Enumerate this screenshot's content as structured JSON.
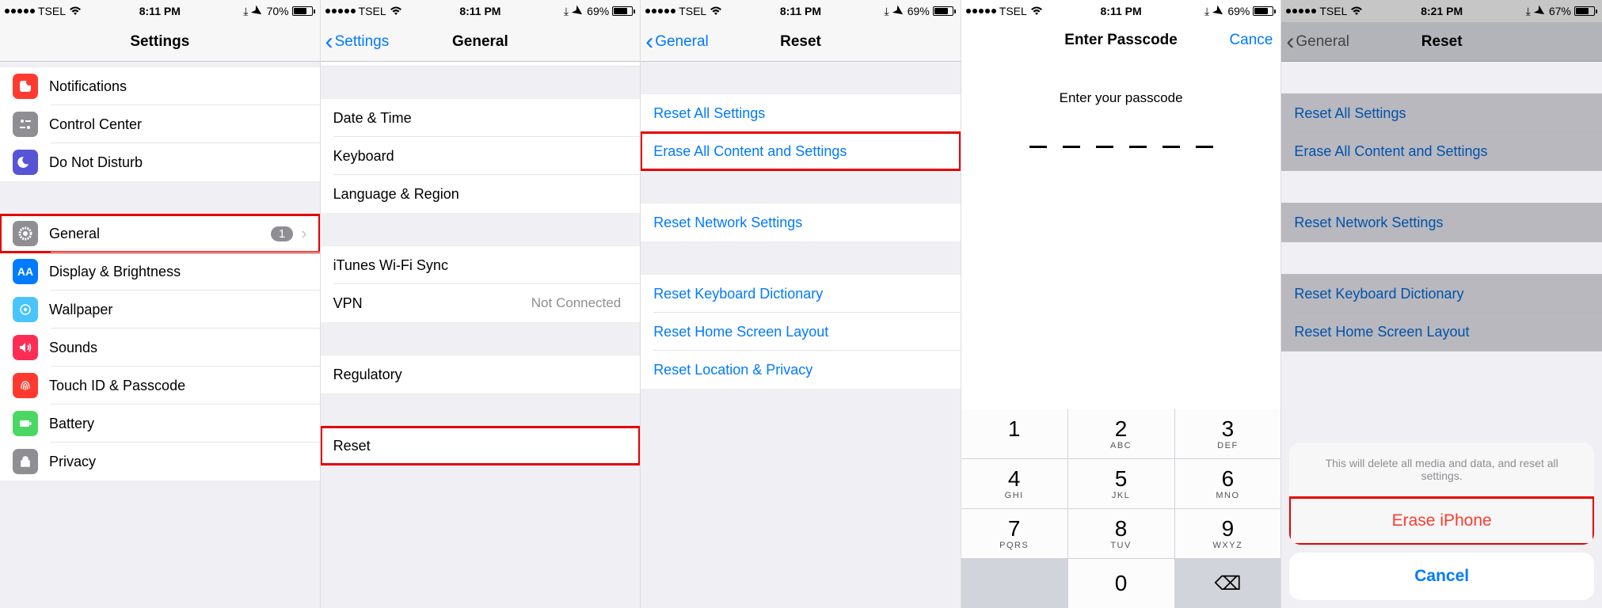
{
  "status": {
    "carrier": "TSEL",
    "time1": "8:11 PM",
    "time2": "8:11 PM",
    "time3": "8:11 PM",
    "time4": "8:11 PM",
    "time5": "8:21 PM",
    "bat1": "70%",
    "bat2": "69%",
    "bat3": "69%",
    "bat4": "69%",
    "bat5": "67%"
  },
  "s1": {
    "title": "Settings",
    "rows": {
      "notifications": "Notifications",
      "control_center": "Control Center",
      "dnd": "Do Not Disturb",
      "general": "General",
      "general_badge": "1",
      "display": "Display & Brightness",
      "wallpaper": "Wallpaper",
      "sounds": "Sounds",
      "touchid": "Touch ID & Passcode",
      "battery": "Battery",
      "privacy": "Privacy"
    }
  },
  "s2": {
    "back": "Settings",
    "title": "General",
    "rows": {
      "datetime": "Date & Time",
      "keyboard": "Keyboard",
      "language": "Language & Region",
      "itunes": "iTunes Wi-Fi Sync",
      "vpn": "VPN",
      "vpn_detail": "Not Connected",
      "regulatory": "Regulatory",
      "reset": "Reset"
    }
  },
  "s3": {
    "back": "General",
    "title": "Reset",
    "rows": {
      "reset_all": "Reset All Settings",
      "erase_all": "Erase All Content and Settings",
      "reset_network": "Reset Network Settings",
      "reset_keyboard": "Reset Keyboard Dictionary",
      "reset_home": "Reset Home Screen Layout",
      "reset_location": "Reset Location & Privacy"
    }
  },
  "s4": {
    "title": "Enter Passcode",
    "cancel": "Cance",
    "prompt": "Enter your passcode",
    "keys": {
      "k1": "1",
      "k2": "2",
      "k2l": "ABC",
      "k3": "3",
      "k3l": "DEF",
      "k4": "4",
      "k4l": "GHI",
      "k5": "5",
      "k5l": "JKL",
      "k6": "6",
      "k6l": "MNO",
      "k7": "7",
      "k7l": "PQRS",
      "k8": "8",
      "k8l": "TUV",
      "k9": "9",
      "k9l": "WXYZ",
      "k0": "0"
    }
  },
  "s5": {
    "back": "General",
    "title": "Reset",
    "rows": {
      "reset_all": "Reset All Settings",
      "erase_all": "Erase All Content and Settings",
      "reset_network": "Reset Network Settings",
      "reset_keyboard": "Reset Keyboard Dictionary",
      "reset_home": "Reset Home Screen Layout"
    },
    "sheet": {
      "msg": "This will delete all media and data, and reset all settings.",
      "erase": "Erase iPhone",
      "cancel": "Cancel"
    }
  }
}
